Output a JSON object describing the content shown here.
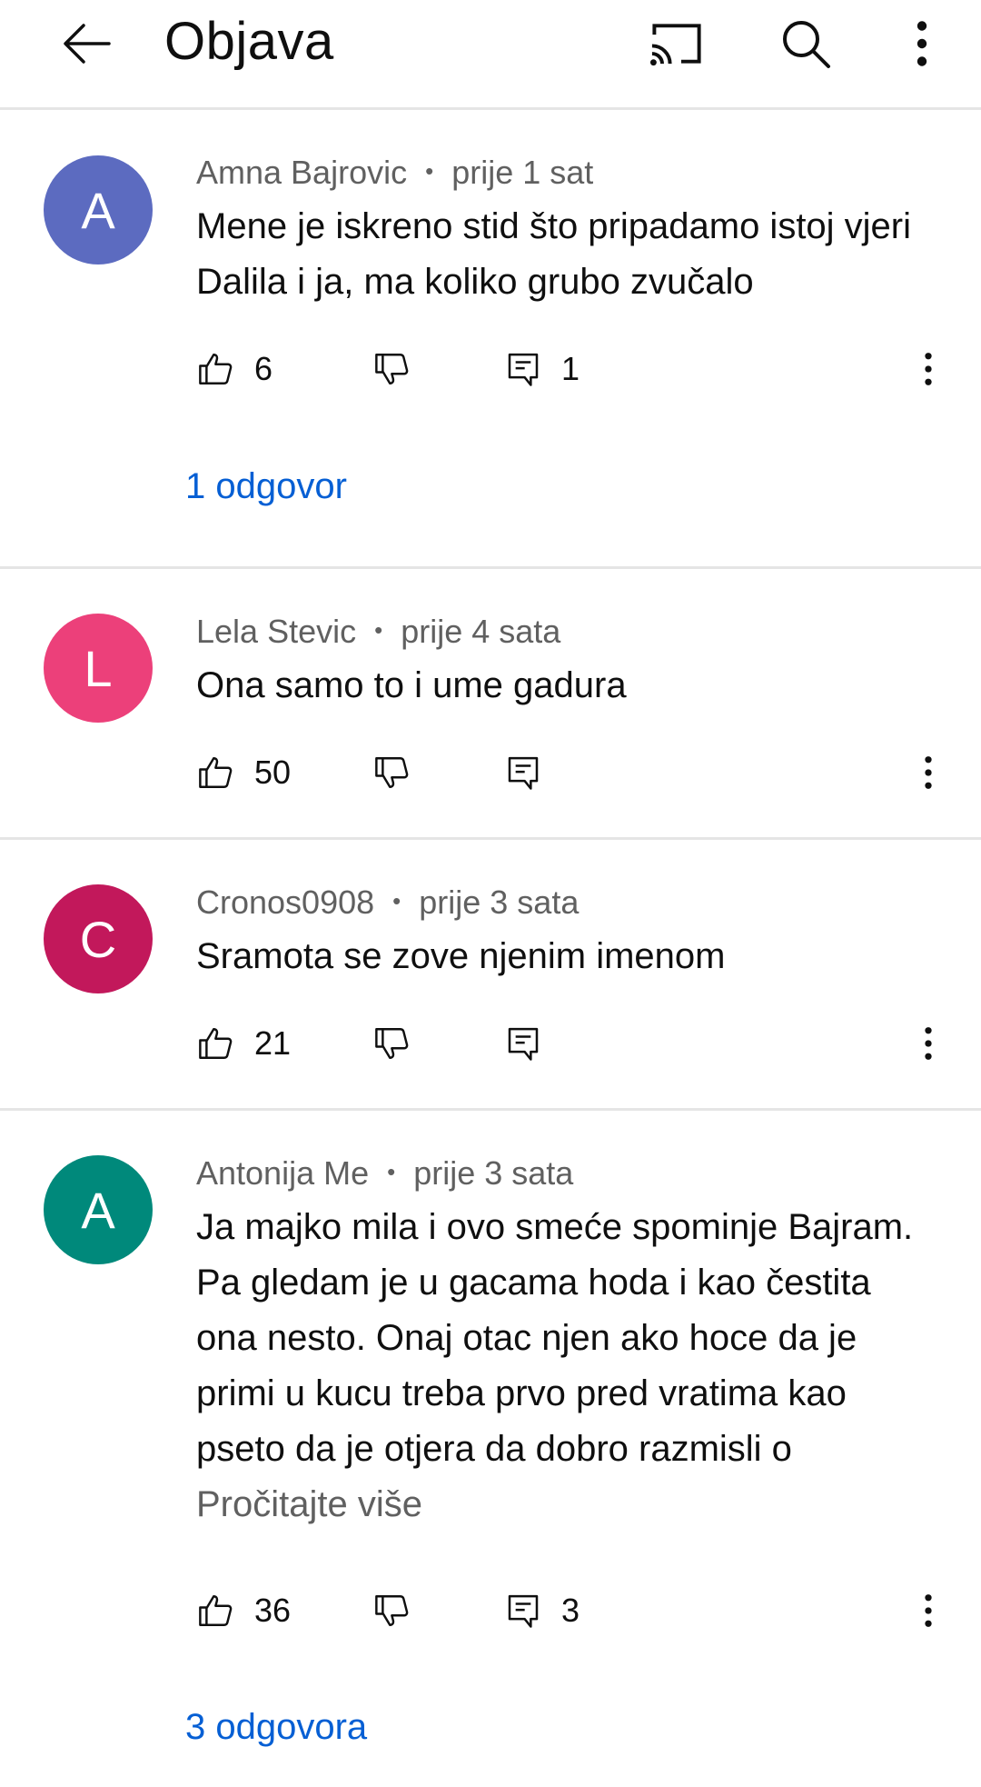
{
  "header": {
    "title": "Objava",
    "icons": [
      "arrow-left-icon",
      "cast-icon",
      "search-icon",
      "more-vert-icon"
    ]
  },
  "comments": [
    {
      "avatar_letter": "A",
      "avatar_color": "#5c6bc0",
      "author": "Amna Bajrovic",
      "time": "prije 1 sat",
      "text": "Mene je iskreno stid što pripadamo istoj vjeri Dalila i ja, ma koliko grubo zvučalo",
      "likes": "6",
      "reply_count": "1",
      "replies_link": "1 odgovor"
    },
    {
      "avatar_letter": "L",
      "avatar_color": "#ec407a",
      "author": "Lela Stevic",
      "time": "prije 4 sata",
      "text": "Ona samo to i ume gadura",
      "likes": "50",
      "reply_count": "",
      "replies_link": ""
    },
    {
      "avatar_letter": "C",
      "avatar_color": "#c2185b",
      "author": "Cronos0908",
      "time": "prije 3 sata",
      "text": "Sramota se zove njenim imenom",
      "likes": "21",
      "reply_count": "",
      "replies_link": ""
    },
    {
      "avatar_letter": "A",
      "avatar_color": "#00897b",
      "author": "Antonija Me",
      "time": "prije 3 sata",
      "text": "Ja majko mila i ovo smeće spominje Bajram. Pa gledam je u gacama hoda i kao čestita ona nesto. Onaj otac njen ako hoce da je primi u kucu treba prvo pred vratima kao pseto da je otjera da dobro razmisli o",
      "read_more": "Pročitajte više",
      "likes": "36",
      "reply_count": "3",
      "replies_link": "3 odgovora"
    }
  ],
  "meta_separator": "•"
}
